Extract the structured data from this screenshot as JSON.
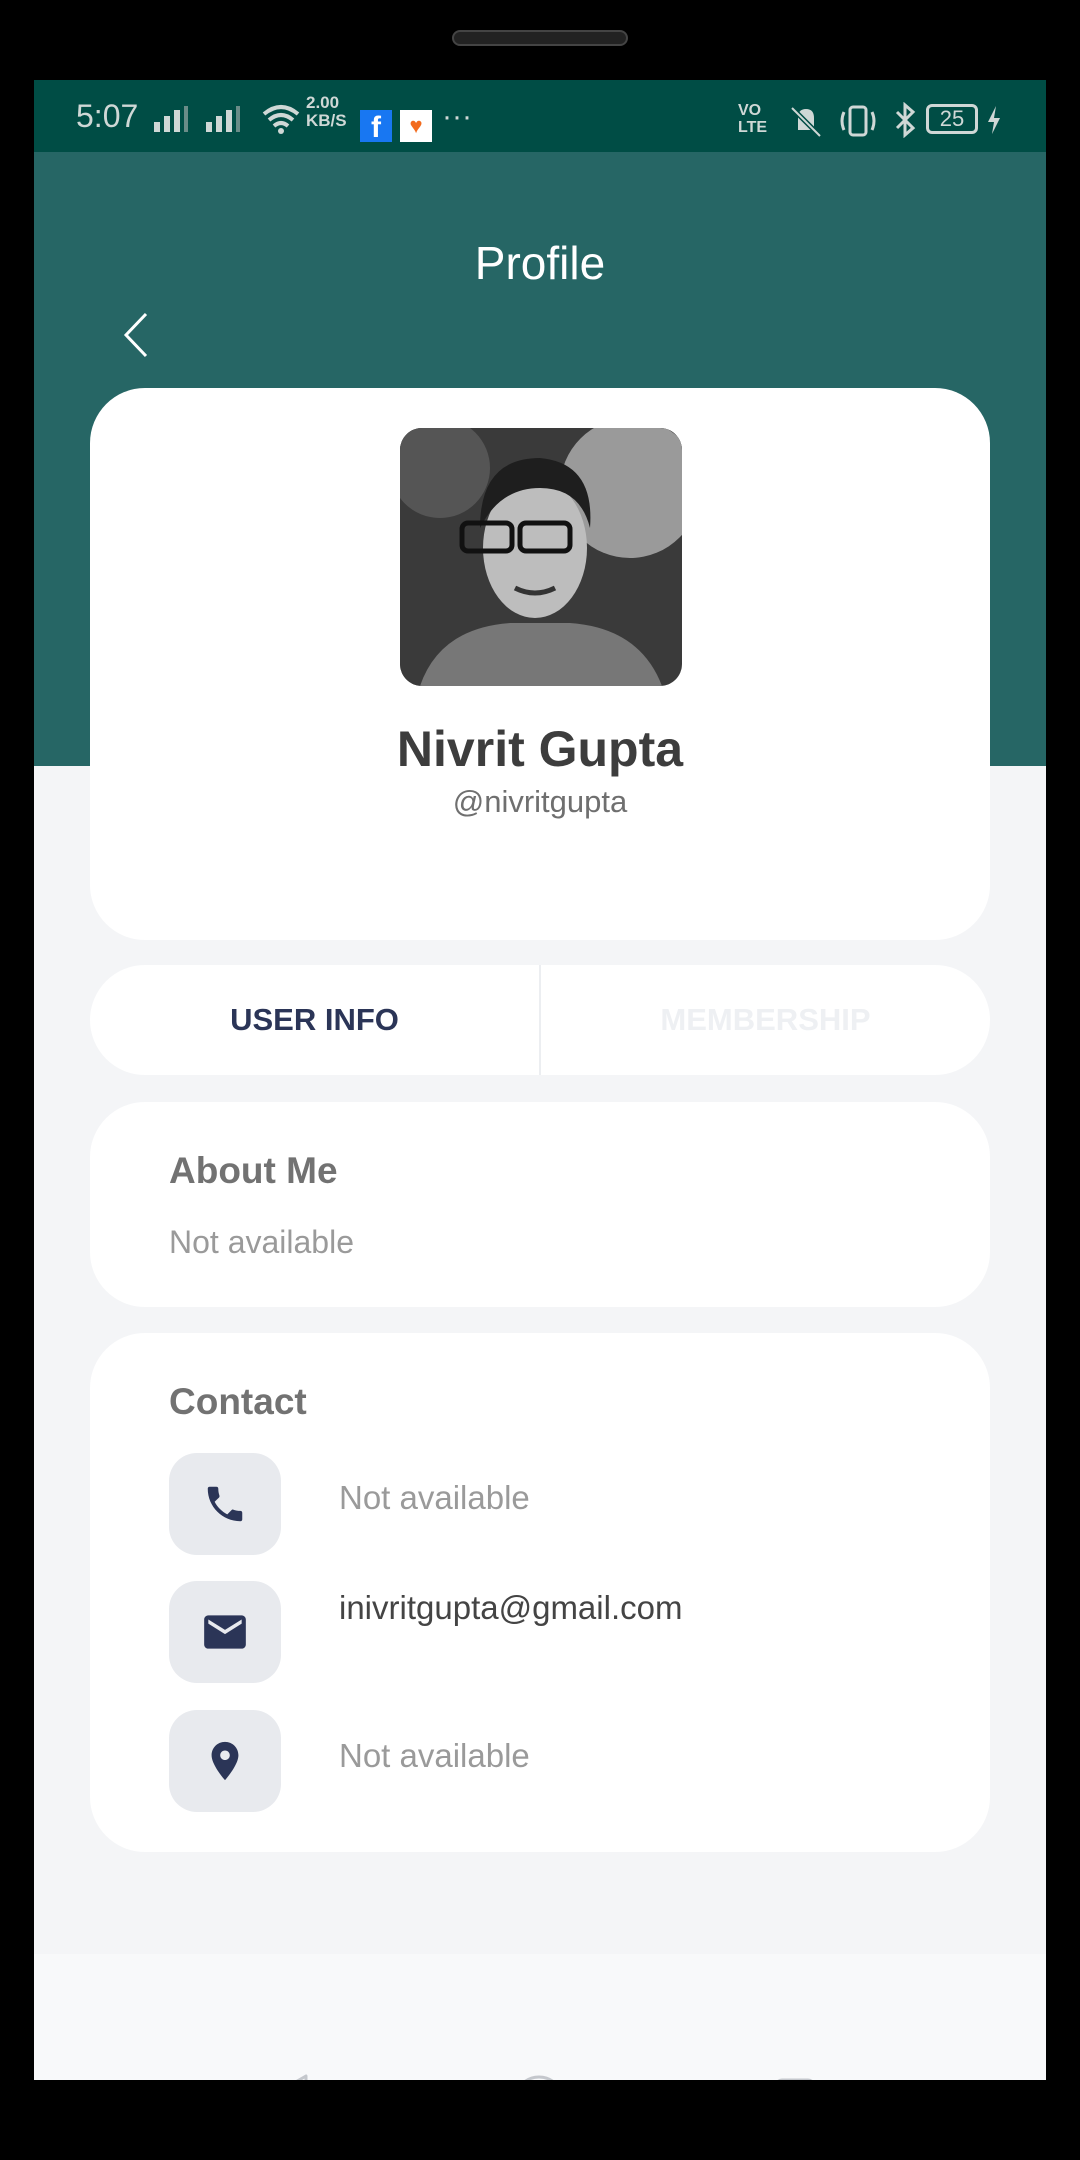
{
  "status_bar": {
    "time": "5:07",
    "net_speed_value": "2.00",
    "net_speed_unit": "KB/S",
    "more": "···",
    "volte": "VO LTE",
    "battery": "25",
    "icons": [
      "signal-icon",
      "signal-icon",
      "wifi-icon",
      "facebook-icon",
      "aarogya-setu-icon",
      "volte-icon",
      "mute-icon",
      "vibrate-icon",
      "bluetooth-icon",
      "battery-icon",
      "charging-icon"
    ]
  },
  "header": {
    "title": "Profile",
    "back_icon": "chevron-left-icon",
    "color": "#266665"
  },
  "profile": {
    "name": "Nivrit Gupta",
    "handle": "@nivritgupta"
  },
  "tabs": [
    {
      "label": "USER INFO",
      "active": true
    },
    {
      "label": "MEMBERSHIP",
      "active": false
    }
  ],
  "about": {
    "title": "About Me",
    "text": "Not available"
  },
  "contact": {
    "title": "Contact",
    "items": [
      {
        "icon": "phone-icon",
        "text": "Not available"
      },
      {
        "icon": "email-icon",
        "text": "inivritgupta@gmail.com"
      },
      {
        "icon": "location-icon",
        "text": "Not available"
      }
    ]
  },
  "nav": {
    "icons": [
      "chevron-down-icon",
      "back-triangle-icon",
      "home-circle-icon",
      "recents-square-icon"
    ]
  }
}
